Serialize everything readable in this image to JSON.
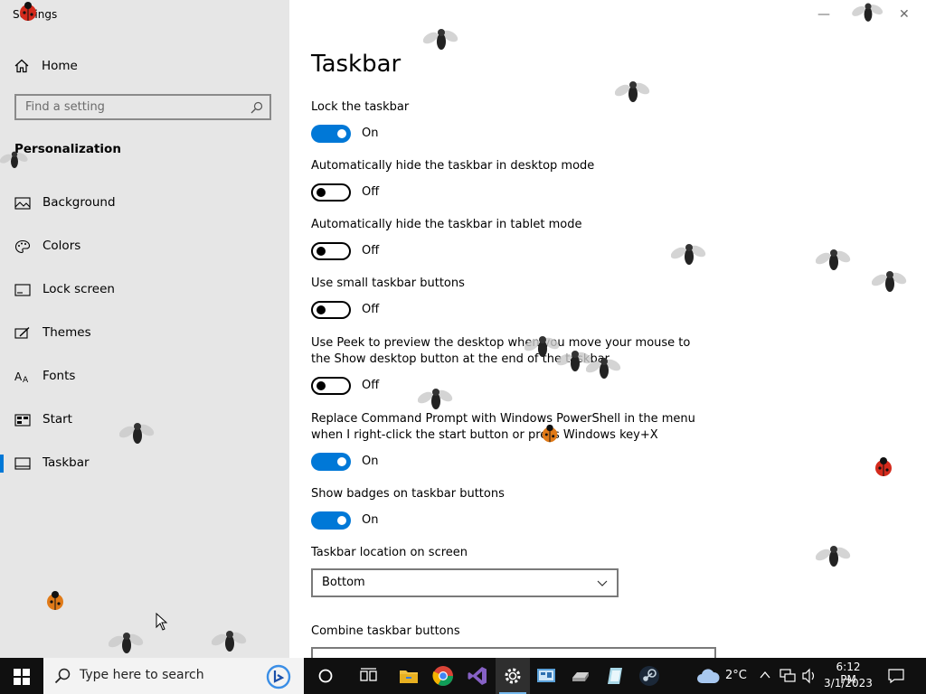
{
  "window": {
    "title": "Settings",
    "minimize_glyph": "—",
    "close_glyph": "✕"
  },
  "sidebar": {
    "home_label": "Home",
    "search_placeholder": "Find a setting",
    "section_heading": "Personalization",
    "items": [
      {
        "label": "Background",
        "icon": "picture-icon",
        "selected": false
      },
      {
        "label": "Colors",
        "icon": "palette-icon",
        "selected": false
      },
      {
        "label": "Lock screen",
        "icon": "lock-screen-icon",
        "selected": false
      },
      {
        "label": "Themes",
        "icon": "themes-icon",
        "selected": false
      },
      {
        "label": "Fonts",
        "icon": "fonts-icon",
        "selected": false
      },
      {
        "label": "Start",
        "icon": "start-icon",
        "selected": false
      },
      {
        "label": "Taskbar",
        "icon": "taskbar-icon",
        "selected": true
      }
    ]
  },
  "page": {
    "title": "Taskbar",
    "settings": [
      {
        "label": "Lock the taskbar",
        "state": "On",
        "on": true
      },
      {
        "label": "Automatically hide the taskbar in desktop mode",
        "state": "Off",
        "on": false
      },
      {
        "label": "Automatically hide the taskbar in tablet mode",
        "state": "Off",
        "on": false
      },
      {
        "label": "Use small taskbar buttons",
        "state": "Off",
        "on": false
      },
      {
        "label": "Use Peek to preview the desktop when you move your mouse to the Show desktop button at the end of the taskbar",
        "state": "Off",
        "on": false
      },
      {
        "label": "Replace Command Prompt with Windows PowerShell in the menu when I right-click the start button or press Windows key+X",
        "state": "On",
        "on": true
      },
      {
        "label": "Show badges on taskbar buttons",
        "state": "On",
        "on": true
      }
    ],
    "location_label": "Taskbar location on screen",
    "location_value": "Bottom",
    "combine_label": "Combine taskbar buttons"
  },
  "taskbar": {
    "search_placeholder": "Type here to search",
    "temperature": "2°C",
    "time": "6:12 PM",
    "date": "3/1/2023",
    "apps": [
      "task-view-icon",
      "file-explorer-icon",
      "chrome-icon",
      "visual-studio-icon",
      "settings-icon",
      "control-panel-icon",
      "drive-icon",
      "notepad-icon",
      "steam-icon"
    ]
  },
  "colors": {
    "accent": "#0078d7",
    "sidebar_bg": "#e6e6e6",
    "taskbar_bg": "#101010"
  }
}
